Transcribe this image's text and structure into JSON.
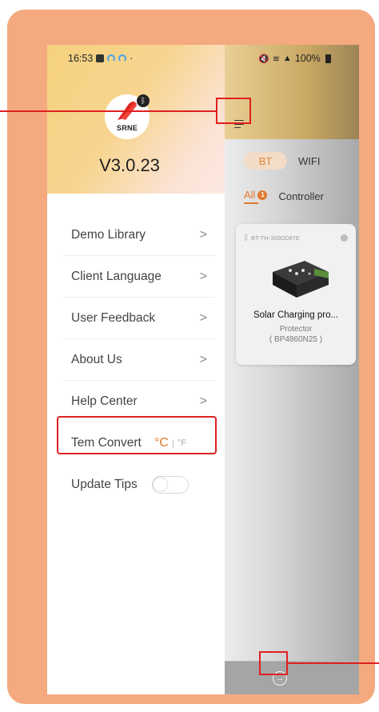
{
  "drawer": {
    "status_time": "16:53",
    "logo_text": "SRNE",
    "version": "V3.0.23",
    "menu_items": [
      {
        "label": "Demo Library"
      },
      {
        "label": "Client Language"
      },
      {
        "label": "User Feedback"
      },
      {
        "label": "About Us"
      },
      {
        "label": "Help Center"
      }
    ],
    "chevron": ">",
    "temp": {
      "label": "Tem Convert",
      "celsius": "°C",
      "separator": "|",
      "fahrenheit": "°F"
    },
    "update_tips": {
      "label": "Update Tips",
      "enabled": false
    }
  },
  "app": {
    "status_battery": "100%",
    "mode_tabs": {
      "bt": "BT",
      "wifi": "WIFI"
    },
    "filter_tabs": {
      "all": "All",
      "badge": "1",
      "controller": "Controller"
    },
    "device_card": {
      "id": "BT-TH-300DD87E",
      "title": "Solar Charging pro...",
      "subtitle": "Protector",
      "model": "( BP4860N25 )"
    },
    "bottom_nav_icon": "arrow-right-circle-icon"
  },
  "colors": {
    "frame": "#f4a97f",
    "accent": "#e07a2e",
    "highlight": "#e02020",
    "header_gold": "#f5d17e"
  }
}
